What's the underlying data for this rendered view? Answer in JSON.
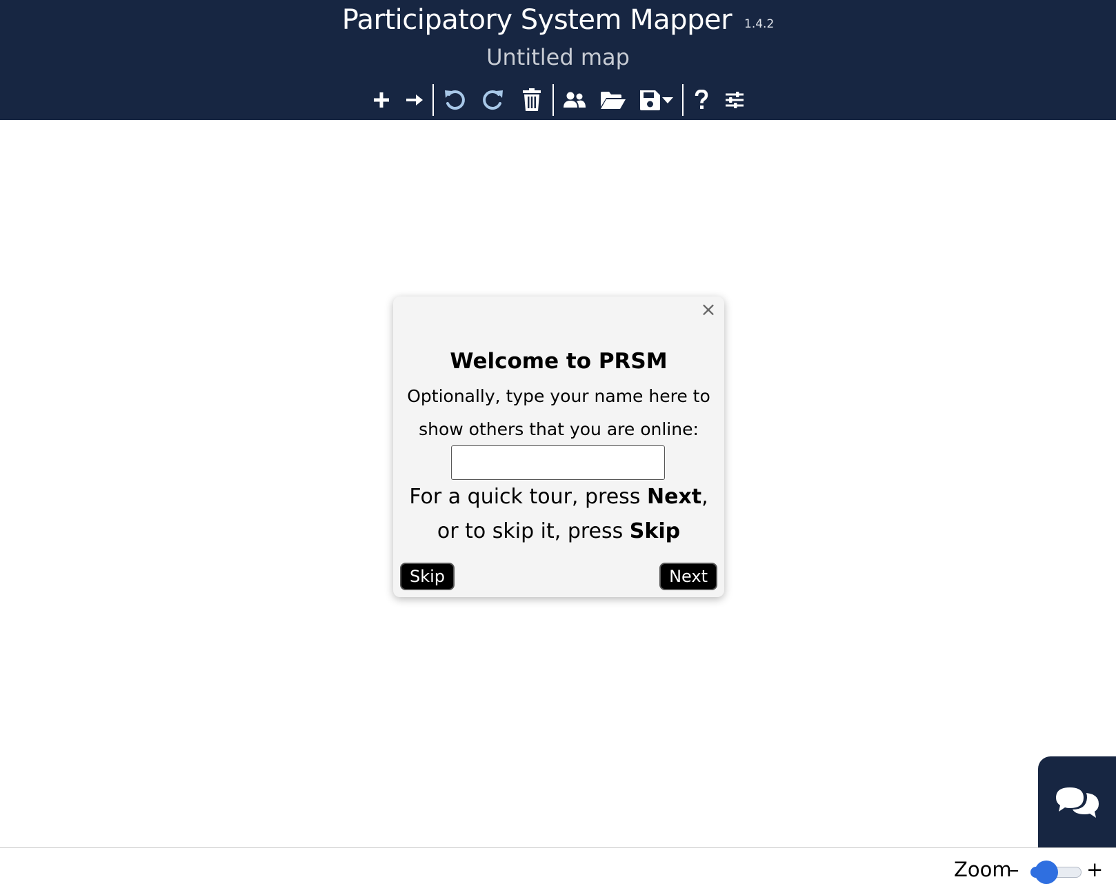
{
  "header": {
    "app_title": "Participatory System Mapper",
    "version": "1.4.2",
    "map_title": "Untitled map"
  },
  "toolbar": {
    "icons": [
      "add-node-icon",
      "add-link-icon",
      "undo-icon",
      "redo-icon",
      "delete-icon",
      "share-icon",
      "open-file-icon",
      "save-icon",
      "help-icon",
      "settings-icon"
    ]
  },
  "dialog": {
    "close_symbol": "×",
    "title": "Welcome to PRSM",
    "prompt_line1": "Optionally, type your name here to",
    "prompt_line2": "show others that you are online:",
    "name_value": "",
    "tour_prefix": "For a quick tour, press ",
    "tour_next": "Next",
    "tour_comma": ",",
    "skip_prefix": "or to skip it, press ",
    "skip_word": "Skip",
    "skip_button": "Skip",
    "next_button": "Next"
  },
  "footer": {
    "zoom_label": "Zoom",
    "zoom_minus": "–",
    "zoom_plus": "+",
    "zoom_level": 0.2
  },
  "colors": {
    "navbar": "#172642",
    "slider_accent": "#2f6fe0"
  }
}
